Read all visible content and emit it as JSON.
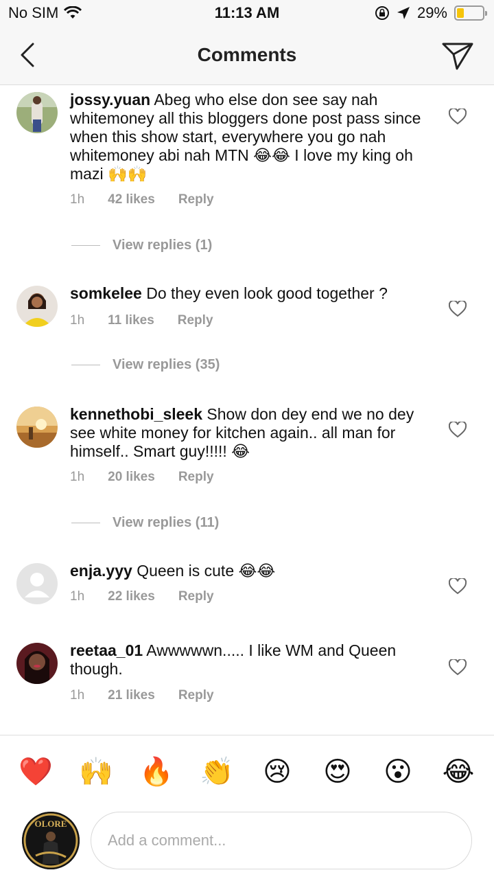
{
  "status_bar": {
    "carrier": "No SIM",
    "time": "11:13 AM",
    "battery_percent": "29%",
    "battery_level": 0.29,
    "icons": [
      "wifi-icon",
      "orientation-lock-icon",
      "location-arrow-icon",
      "battery-icon"
    ]
  },
  "nav": {
    "title": "Comments",
    "back_icon": "chevron-left-icon",
    "send_icon": "paper-plane-icon"
  },
  "comments": [
    {
      "username": "jossy.yuan",
      "text": "Abeg who else don see say nah whitemoney all this bloggers done post pass since when this show start, everywhere you go nah whitemoney abi nah MTN 😂😂 I love my king oh mazi 🙌🙌",
      "time": "1h",
      "likes": "42 likes",
      "reply": "Reply",
      "view_replies": "View replies (1)"
    },
    {
      "username": "somkelee",
      "text": "Do they even look good together ?",
      "time": "1h",
      "likes": "11 likes",
      "reply": "Reply",
      "view_replies": "View replies (35)"
    },
    {
      "username": "kennethobi_sleek",
      "text": "Show don dey end we no dey see white money for kitchen again.. all man for himself.. Smart guy!!!!! 😂",
      "time": "1h",
      "likes": "20 likes",
      "reply": "Reply",
      "view_replies": "View replies (11)"
    },
    {
      "username": "enja.yyy",
      "text": "Queen is cute 😂😂",
      "time": "1h",
      "likes": "22 likes",
      "reply": "Reply"
    },
    {
      "username": "reetaa_01",
      "text": "Awwwwwn..... I like WM and Queen though.",
      "time": "1h",
      "likes": "21 likes",
      "reply": "Reply"
    }
  ],
  "emoji_bar": [
    "❤️",
    "🙌",
    "🔥",
    "👏",
    "😢",
    "😍",
    "😮",
    "😂"
  ],
  "composer": {
    "placeholder": "Add a comment...",
    "avatar_text": "OLORE"
  }
}
